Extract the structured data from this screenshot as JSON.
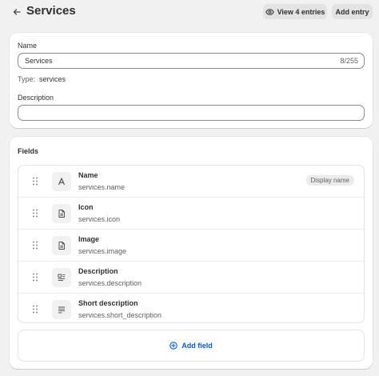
{
  "header": {
    "title": "Services",
    "view_entries_label": "View 4 entries",
    "add_entry_label": "Add entry"
  },
  "definition": {
    "name_label": "Name",
    "name_value": "Services",
    "name_count": "8/255",
    "type_label": "Type:",
    "type_value": "services",
    "description_label": "Description",
    "description_value": ""
  },
  "fields": {
    "title": "Fields",
    "items": [
      {
        "name": "Name",
        "key": "services.name",
        "icon": "text-icon",
        "badge": "Display name"
      },
      {
        "name": "Icon",
        "key": "services.icon",
        "icon": "file-icon"
      },
      {
        "name": "Image",
        "key": "services.image",
        "icon": "file-icon"
      },
      {
        "name": "Description",
        "key": "services.description",
        "icon": "rich-text-icon"
      },
      {
        "name": "Short description",
        "key": "services.short_description",
        "icon": "multiline-text-icon"
      }
    ],
    "add_label": "Add field"
  },
  "colors": {
    "accent": "#005bd3",
    "background": "#f1f1f1"
  }
}
